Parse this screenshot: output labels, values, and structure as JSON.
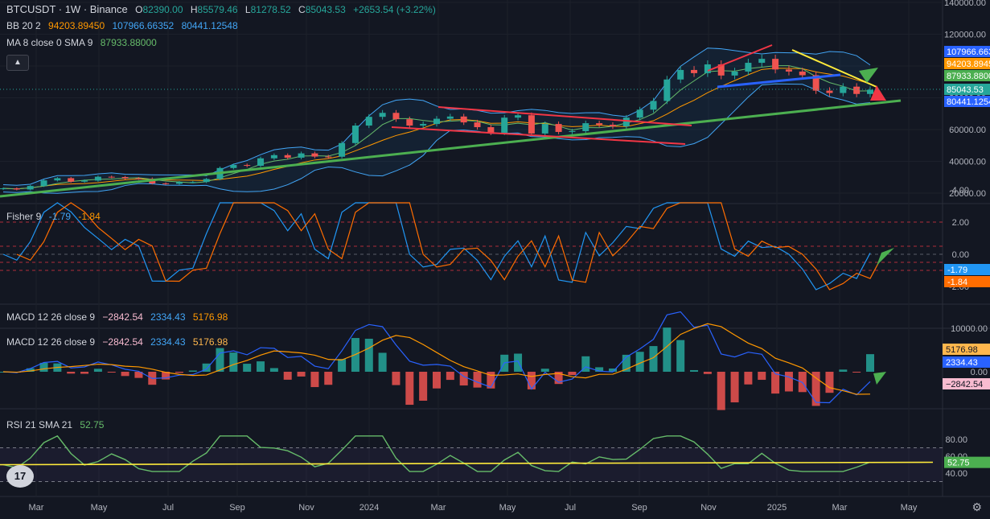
{
  "header": {
    "symbol": "BTCUSDT · 1W · Binance",
    "o_label": "O",
    "o": "82390.00",
    "h_label": "H",
    "h": "85579.46",
    "l_label": "L",
    "l": "81278.52",
    "c_label": "C",
    "c": "85043.53",
    "change": "+2653.54 (+3.22%)"
  },
  "bb_legend": {
    "name": "BB 20 2",
    "basis": "94203.89450",
    "upper": "107966.66352",
    "lower": "80441.12548"
  },
  "ma_legend": {
    "name": "MA 8 close 0 SMA 9",
    "value": "87933.88000"
  },
  "fisher_legend": {
    "name": "Fisher 9",
    "v1": "-1.79",
    "v2": "-1.84"
  },
  "macd1_legend": {
    "name": "MACD 12 26 close 9",
    "hist": "−2842.54",
    "macd": "2334.43",
    "signal": "5176.98"
  },
  "macd2_legend": {
    "name": "MACD 12 26 close 9",
    "hist": "−2842.54",
    "macd": "2334.43",
    "signal": "5176.98"
  },
  "rsi_legend": {
    "name": "RSI 21 SMA 21",
    "value": "52.75"
  },
  "collapse_icon": "chevron-up-icon",
  "logo_text": "17",
  "colors": {
    "bg": "#131722",
    "up": "#26a69a",
    "down": "#ef5350",
    "grid": "#1e222d",
    "bb": "#2962ff",
    "ma": "#ff9800",
    "green_line": "#4caf50",
    "fisher1": "#2196f3",
    "fisher2": "#ff6d00",
    "macd": "#2962ff",
    "signal": "#ff9800",
    "rsi": "#7e57c2"
  },
  "chart_data": {
    "type": "candlestick",
    "x_labels": [
      "Mar",
      "May",
      "Jul",
      "Sep",
      "Nov",
      "2024",
      "Mar",
      "May",
      "Jul",
      "Sep",
      "Nov",
      "2025",
      "Mar",
      "May"
    ],
    "main_axis": {
      "ticks": [
        "140000.00",
        "120000.00",
        "100000.00",
        "80000.00",
        "60000.00",
        "40000.00",
        "20000.00"
      ],
      "range": [
        20000,
        140000
      ]
    },
    "price_tags": [
      {
        "label": "107966.663",
        "color": "#2962ff"
      },
      {
        "label": "94203.8945",
        "color": "#ff9800"
      },
      {
        "label": "87933.8800",
        "color": "#4caf50"
      },
      {
        "label": "85043.53",
        "color": "#26a69a"
      },
      {
        "label": "80441.1254",
        "color": "#2962ff"
      }
    ],
    "close_series": [
      23000,
      22300,
      24500,
      28000,
      29400,
      27200,
      27900,
      30300,
      30100,
      29300,
      29100,
      26100,
      25900,
      26900,
      27000,
      28900,
      35800,
      37700,
      37200,
      41900,
      43900,
      42300,
      45000,
      43000,
      42900,
      51500,
      62500,
      68000,
      70500,
      66500,
      62500,
      63500,
      66800,
      68200,
      64500,
      61500,
      58000,
      67500,
      69000,
      57500,
      63500,
      58500,
      59000,
      64000,
      63000,
      62000,
      67500,
      72500,
      78000,
      91500,
      97500,
      95500,
      101000,
      94000,
      96500,
      102000,
      104500,
      97800,
      96500,
      94200,
      84500,
      83000,
      87000,
      82400,
      85043
    ],
    "main_overlays": {
      "bb_upper": "107966.66352",
      "bb_basis": "94203.89450",
      "bb_lower": "80441.12548",
      "ma": "87933.88000"
    },
    "fisher_axis": {
      "ticks": [
        "4.00",
        "2.00",
        "0.00",
        "-2.00"
      ],
      "last": [
        "-1.79",
        "-1.84"
      ]
    },
    "macd_axis": {
      "ticks": [
        "10000.00",
        "0.00"
      ],
      "last": [
        "5176.98",
        "2334.43",
        "−2842.54"
      ]
    },
    "rsi_axis": {
      "ticks": [
        "80.00",
        "60.00",
        "40.00"
      ],
      "last": "52.75",
      "bands": [
        70,
        30
      ]
    }
  }
}
